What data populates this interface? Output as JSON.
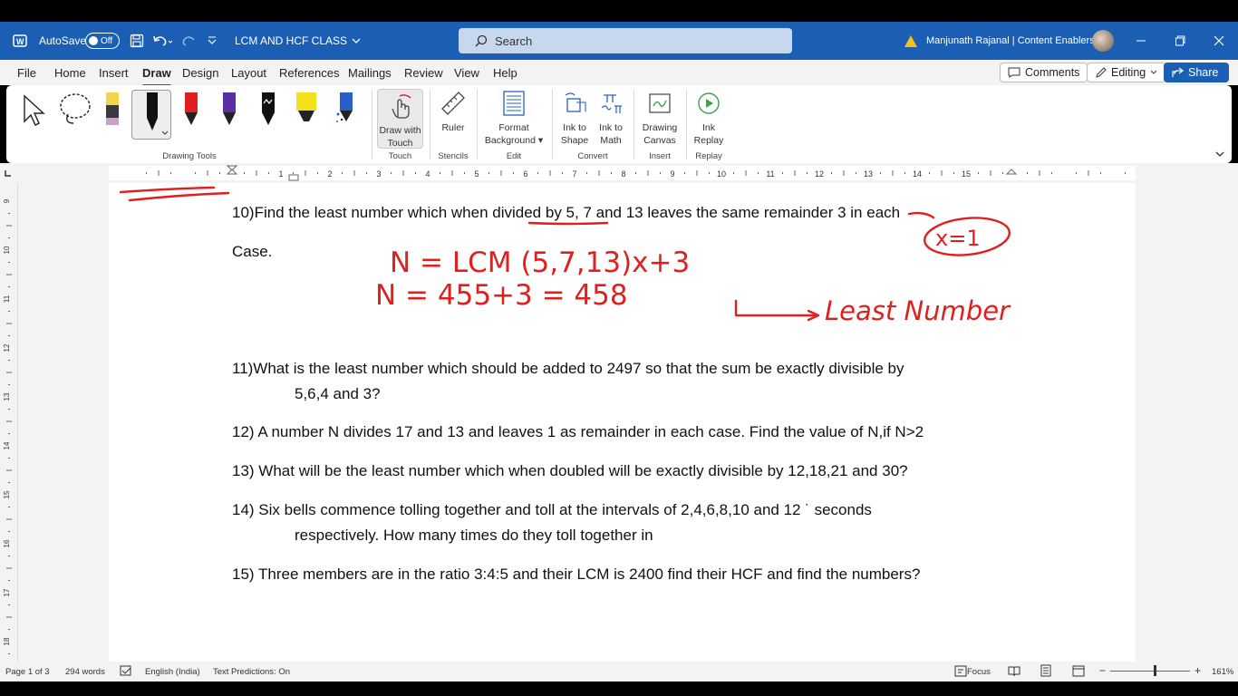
{
  "window": {
    "autosave_label": "AutoSave",
    "autosave_state": "Off",
    "doc_title": "LCM AND HCF CLASS",
    "search_placeholder": "Search",
    "user_name": "Manjunath Rajanal | Content Enablers"
  },
  "menu": {
    "tabs": [
      "File",
      "Home",
      "Insert",
      "Draw",
      "Design",
      "Layout",
      "References",
      "Mailings",
      "Review",
      "View",
      "Help"
    ],
    "active_tab": "Draw",
    "comments_label": "Comments",
    "editing_label": "Editing",
    "share_label": "Share"
  },
  "ribbon": {
    "groups": {
      "drawing_tools": "Drawing Tools",
      "touch": "Touch",
      "stencils": "Stencils",
      "edit": "Edit",
      "convert": "Convert",
      "insert": "Insert",
      "replay": "Replay"
    },
    "buttons": {
      "draw_with_touch_1": "Draw with",
      "draw_with_touch_2": "Touch",
      "ruler": "Ruler",
      "format_bg_1": "Format",
      "format_bg_2": "Background",
      "ink_to_shape_1": "Ink to",
      "ink_to_shape_2": "Shape",
      "ink_to_math_1": "Ink to",
      "ink_to_math_2": "Math",
      "drawing_canvas_1": "Drawing",
      "drawing_canvas_2": "Canvas",
      "ink_replay_1": "Ink",
      "ink_replay_2": "Replay"
    },
    "pen_colors": [
      "#f4d44a",
      "#111111",
      "#e02020",
      "#5b2ea6",
      "#111111",
      "#f2e21a",
      "#2a5fc9"
    ]
  },
  "ruler": {
    "h_ticks": [
      "1",
      "2",
      "3",
      "4",
      "5",
      "6",
      "7",
      "8",
      "9",
      "10",
      "11",
      "12",
      "13",
      "14",
      "15"
    ],
    "v_ticks": [
      "9",
      "10",
      "11",
      "12",
      "13",
      "14",
      "15",
      "16",
      "17",
      "18"
    ]
  },
  "document": {
    "q10_line1": "10)Find the least number which when divided by 5, 7 and 13 leaves the same remainder 3 in each",
    "q10_line2": "Case.",
    "q11_line1": "11)What is the least number which should be added to 2497 so that the sum be exactly divisible by",
    "q11_line2": "5,6,4 and 3?",
    "q12": "12) A number N divides 17 and 13 and leaves 1 as remainder in each case. Find the value of N,if N>2",
    "q13": "13) What will be the least number which when doubled will be exactly divisible by 12,18,21 and 30?",
    "q14_line1": "14) Six bells commence tolling together and toll at the intervals of 2,4,6,8,10 and 12 ˙ seconds",
    "q14_line2": "respectively. How many times do they toll together in",
    "q15": "15) Three members are in the ratio 3:4:5 and their LCM is 2400 find their HCF and find the numbers?"
  },
  "ink": {
    "color": "#e0201f",
    "line1": "N = LCM (5,7,13)x+3",
    "line2": "N = 455+3 = 458",
    "circle": "x=1",
    "arrow_label": "Least Number"
  },
  "status": {
    "page": "Page 1 of 3",
    "words": "294 words",
    "language": "English (India)",
    "predictions": "Text Predictions: On",
    "focus": "Focus",
    "zoom": "161%"
  }
}
